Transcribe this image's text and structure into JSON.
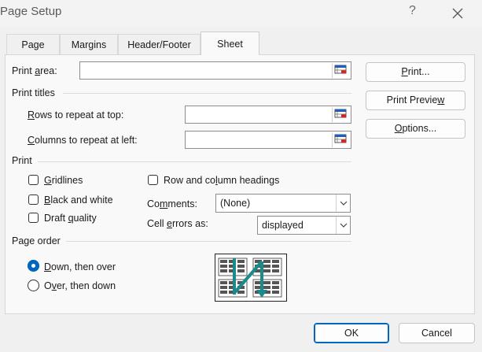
{
  "window": {
    "title": "Page Setup",
    "help": "?"
  },
  "tabs": [
    {
      "label": "Page"
    },
    {
      "label": "Margins"
    },
    {
      "label": "Header/Footer"
    },
    {
      "label": "Sheet"
    }
  ],
  "sheet": {
    "print_area": {
      "pre": "Print ",
      "key": "a",
      "post": "rea:",
      "value": ""
    },
    "print_titles": {
      "heading": "Print titles",
      "rows": {
        "key": "R",
        "post": "ows to repeat at top:",
        "value": ""
      },
      "cols": {
        "key": "C",
        "post": "olumns to repeat at left:",
        "value": ""
      }
    },
    "print": {
      "heading": "Print",
      "gridlines": {
        "key": "G",
        "post": "ridlines",
        "checked": false
      },
      "black_white": {
        "pre": "",
        "key": "B",
        "post": "lack and white",
        "checked": false
      },
      "draft": {
        "pre": "Draft ",
        "key": "q",
        "post": "uality",
        "checked": false
      },
      "row_col_headings": {
        "pre": "Row and co",
        "key": "l",
        "post": "umn headings",
        "checked": false
      },
      "comments": {
        "pre": "Co",
        "key": "m",
        "post": "ments:",
        "value": "(None)"
      },
      "cell_errors": {
        "pre": "Cell ",
        "key": "e",
        "post": "rrors as:",
        "value": "displayed"
      }
    },
    "page_order": {
      "heading": "Page order",
      "down_over": {
        "pre": "",
        "key": "D",
        "post": "own, then over",
        "selected": true
      },
      "over_down": {
        "pre": "O",
        "key": "v",
        "post": "er, then down",
        "selected": false
      }
    }
  },
  "side_buttons": {
    "print": {
      "pre": "",
      "key": "P",
      "post": "rint..."
    },
    "preview": {
      "pre": "Print Previe",
      "key": "w",
      "post": ""
    },
    "options": {
      "pre": "",
      "key": "O",
      "post": "ptions..."
    }
  },
  "footer": {
    "ok": "OK",
    "cancel": "Cancel"
  },
  "colors": {
    "accent": "#0067c0",
    "teal_arrow": "#1a8a8a"
  }
}
